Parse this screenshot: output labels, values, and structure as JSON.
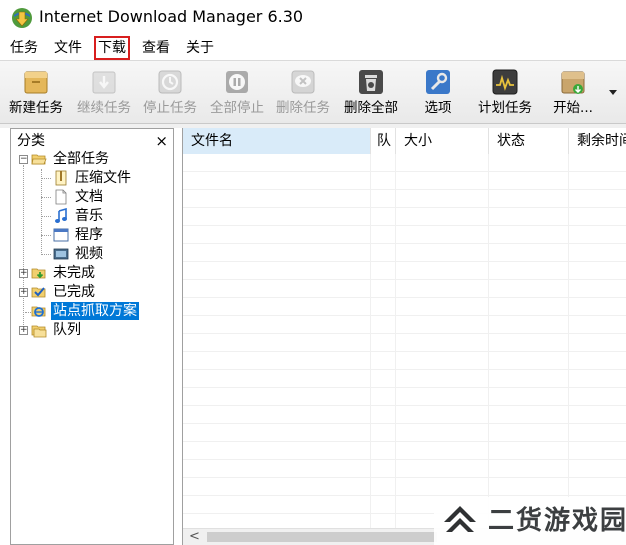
{
  "window": {
    "title": "Internet Download Manager 6.30"
  },
  "menu": [
    "任务",
    "文件",
    "下载",
    "查看",
    "关于"
  ],
  "toolbar": [
    {
      "label": "新建任务",
      "icon": "new-task-icon",
      "enabled": true
    },
    {
      "label": "继续任务",
      "icon": "resume-icon",
      "enabled": false
    },
    {
      "label": "停止任务",
      "icon": "stop-icon",
      "enabled": false
    },
    {
      "label": "全部停止",
      "icon": "stop-all-icon",
      "enabled": false
    },
    {
      "label": "删除任务",
      "icon": "delete-icon",
      "enabled": false
    },
    {
      "label": "删除全部",
      "icon": "delete-all-icon",
      "enabled": true
    },
    {
      "label": "选项",
      "icon": "options-icon",
      "enabled": true
    },
    {
      "label": "计划任务",
      "icon": "scheduler-icon",
      "enabled": true
    },
    {
      "label": "开始...",
      "icon": "start-icon",
      "enabled": true
    }
  ],
  "sidebar": {
    "header": "分类",
    "close": "×",
    "tree": [
      {
        "label": "全部任务",
        "icon": "folder-open-icon"
      },
      {
        "label": "压缩文件",
        "icon": "archive-icon"
      },
      {
        "label": "文档",
        "icon": "document-icon"
      },
      {
        "label": "音乐",
        "icon": "music-icon"
      },
      {
        "label": "程序",
        "icon": "program-icon"
      },
      {
        "label": "视频",
        "icon": "video-icon"
      },
      {
        "label": "未完成",
        "icon": "unfinished-icon"
      },
      {
        "label": "已完成",
        "icon": "finished-icon"
      },
      {
        "label": "站点抓取方案",
        "icon": "site-grabber-icon"
      },
      {
        "label": "队列",
        "icon": "queue-icon"
      }
    ]
  },
  "table": {
    "columns": [
      "文件名",
      "队",
      "大小",
      "状态",
      "剩余时间"
    ]
  },
  "watermark": {
    "text": "二货游戏园"
  },
  "colors": {
    "selection": "#0078d7",
    "menu_highlight": "#d81e1e"
  }
}
